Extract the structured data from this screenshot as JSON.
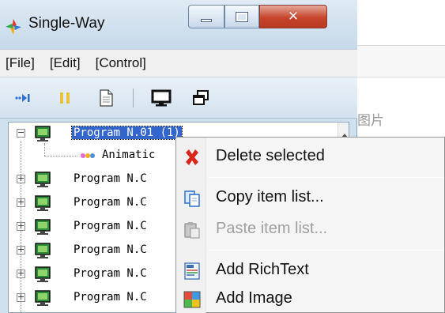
{
  "window": {
    "title": "Single-Way"
  },
  "menubar": {
    "items": [
      {
        "label": "[File]"
      },
      {
        "label": "[Edit]"
      },
      {
        "label": "[Control]"
      }
    ]
  },
  "toolbar": {
    "tools": [
      {
        "icon": "play-step-icon"
      },
      {
        "icon": "pause-icon"
      },
      {
        "icon": "document-icon"
      },
      {
        "icon": "monitor-icon"
      },
      {
        "icon": "windows-stack-icon"
      }
    ]
  },
  "background": {
    "tab_label": "图片"
  },
  "tree": {
    "rows": [
      {
        "label": "Program N.01  (1)",
        "expander": "−",
        "selected": true
      },
      {
        "label": "Animatic",
        "child": true
      },
      {
        "label": "Program N.C",
        "expander": "+"
      },
      {
        "label": "Program N.C",
        "expander": "+"
      },
      {
        "label": "Program N.C",
        "expander": "+"
      },
      {
        "label": "Program N.C",
        "expander": "+"
      },
      {
        "label": "Program N.C",
        "expander": "+"
      },
      {
        "label": "Program N.C",
        "expander": "+"
      }
    ]
  },
  "context_menu": {
    "items": [
      {
        "label": "Delete selected",
        "icon": "delete-x-icon",
        "enabled": true
      },
      {
        "label": "Copy item list...",
        "icon": "copy-icon",
        "enabled": true
      },
      {
        "label": "Paste item list...",
        "icon": "paste-icon",
        "enabled": false
      },
      {
        "label": "Add RichText",
        "icon": "richtext-icon",
        "enabled": true
      },
      {
        "label": "Add Image",
        "icon": "image-icon",
        "enabled": true
      }
    ]
  },
  "colors": {
    "selection": "#3366cc",
    "delete_red": "#d9261c",
    "window_frame": "#cfe0ee"
  }
}
